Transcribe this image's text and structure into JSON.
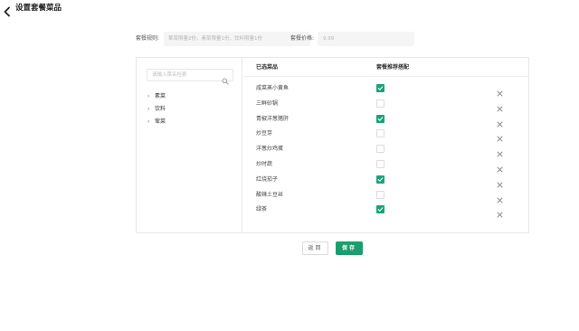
{
  "header": {
    "title": "设置套餐菜品"
  },
  "rules": {
    "label": "套餐规则:",
    "value": "荤菜限量2份，素菜限量1份，饮料限量1份",
    "price_label": "套餐价格:",
    "price_value": "9.99"
  },
  "sidebar": {
    "search_placeholder": "请输入菜名检索",
    "categories": [
      {
        "label": "素菜"
      },
      {
        "label": "饮料"
      },
      {
        "label": "荤菜"
      }
    ]
  },
  "table": {
    "col_dish": "已选菜品",
    "col_recommend": "套餐推荐搭配",
    "rows": [
      {
        "name": "咸菜蒸小黄鱼",
        "checked": true
      },
      {
        "name": "三鲜砂锅",
        "checked": false
      },
      {
        "name": "青椒洋葱猪肝",
        "checked": true
      },
      {
        "name": "炒豆芽",
        "checked": false
      },
      {
        "name": "洋葱炒鸡蛋",
        "checked": false
      },
      {
        "name": "炒时蔬",
        "checked": false
      },
      {
        "name": "红烧茄子",
        "checked": true
      },
      {
        "name": "酸辣土豆丝",
        "checked": false
      },
      {
        "name": "绿茶",
        "checked": true
      }
    ]
  },
  "buttons": {
    "back": "返回",
    "save": "保存"
  },
  "colors": {
    "accent": "#1a9e6e",
    "check": "#1aa27a"
  },
  "icons": {
    "back": "chevron-left-icon",
    "search": "search-icon",
    "remove": "close-icon",
    "expand": "chevron-right-icon"
  }
}
